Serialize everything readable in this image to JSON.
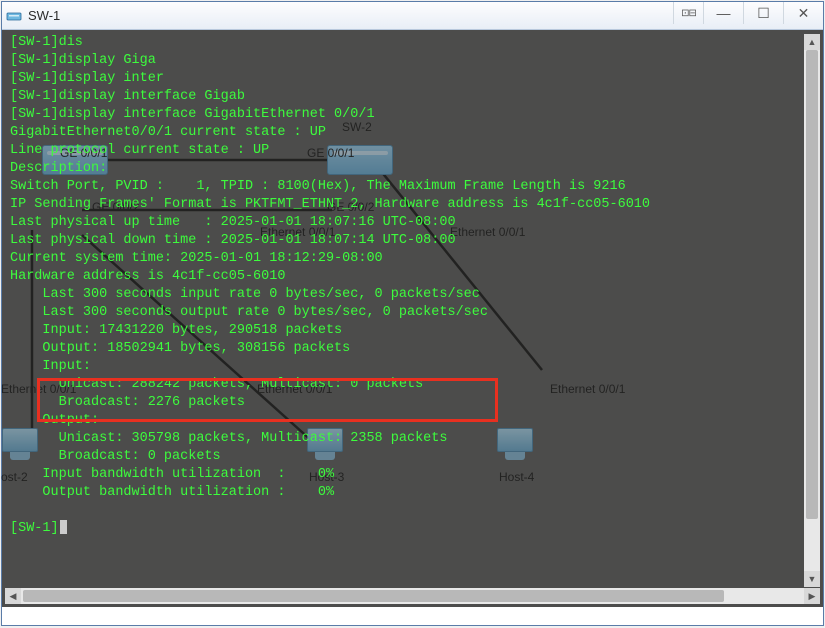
{
  "window": {
    "title": "SW-1"
  },
  "topology": {
    "sw2_label": "SW-2",
    "host2_label": "ost-2",
    "host3_label": "Host-3",
    "host4_label": "Host-4",
    "ge001_a": "GE 0/0/1",
    "ge001_b": "GE 0/0/1",
    "ge002_a": "GE 0/0/2",
    "ge002_b": "GE 0/0/2",
    "eth001_a": "Ethernet 0/0/1",
    "eth001_b": "Ethernet 0/0/1",
    "eth001_c": "Ethernet 0/0/1"
  },
  "terminal": {
    "lines": [
      "[SW-1]dis",
      "[SW-1]display Giga",
      "[SW-1]display inter",
      "[SW-1]display interface Gigab",
      "[SW-1]display interface GigabitEthernet 0/0/1",
      "GigabitEthernet0/0/1 current state : UP",
      "Line protocol current state : UP",
      "Description:",
      "Switch Port, PVID :    1, TPID : 8100(Hex), The Maximum Frame Length is 9216",
      "IP Sending Frames' Format is PKTFMT_ETHNT_2, Hardware address is 4c1f-cc05-6010",
      "Last physical up time   : 2025-01-01 18:07:16 UTC-08:00",
      "Last physical down time : 2025-01-01 18:07:14 UTC-08:00",
      "Current system time: 2025-01-01 18:12:29-08:00",
      "Hardware address is 4c1f-cc05-6010",
      "    Last 300 seconds input rate 0 bytes/sec, 0 packets/sec",
      "    Last 300 seconds output rate 0 bytes/sec, 0 packets/sec",
      "    Input: 17431220 bytes, 290518 packets",
      "    Output: 18502941 bytes, 308156 packets",
      "    Input:",
      "      Unicast: 288242 packets, Multicast: 0 packets",
      "      Broadcast: 2276 packets",
      "    Output:",
      "      Unicast: 305798 packets, Multicast: 2358 packets",
      "      Broadcast: 0 packets",
      "    Input bandwidth utilization  :    0%",
      "    Output bandwidth utilization :    0%",
      "",
      "[SW-1]"
    ]
  },
  "chart_data": {
    "type": "table",
    "title": "display interface GigabitEthernet 0/0/1",
    "rows": [
      {
        "field": "Interface",
        "value": "GigabitEthernet0/0/1"
      },
      {
        "field": "Current state",
        "value": "UP"
      },
      {
        "field": "Line protocol current state",
        "value": "UP"
      },
      {
        "field": "Description",
        "value": ""
      },
      {
        "field": "Switch Port PVID",
        "value": 1
      },
      {
        "field": "TPID (Hex)",
        "value": "8100"
      },
      {
        "field": "Maximum Frame Length",
        "value": 9216
      },
      {
        "field": "IP Sending Frames' Format",
        "value": "PKTFMT_ETHNT_2"
      },
      {
        "field": "Hardware address",
        "value": "4c1f-cc05-6010"
      },
      {
        "field": "Last physical up time",
        "value": "2025-01-01 18:07:16 UTC-08:00"
      },
      {
        "field": "Last physical down time",
        "value": "2025-01-01 18:07:14 UTC-08:00"
      },
      {
        "field": "Current system time",
        "value": "2025-01-01 18:12:29-08:00"
      },
      {
        "field": "Last 300s input rate bytes/sec",
        "value": 0
      },
      {
        "field": "Last 300s input rate packets/sec",
        "value": 0
      },
      {
        "field": "Last 300s output rate bytes/sec",
        "value": 0
      },
      {
        "field": "Last 300s output rate packets/sec",
        "value": 0
      },
      {
        "field": "Input bytes",
        "value": 17431220
      },
      {
        "field": "Input packets",
        "value": 290518
      },
      {
        "field": "Output bytes",
        "value": 18502941
      },
      {
        "field": "Output packets",
        "value": 308156
      },
      {
        "field": "Input Unicast packets",
        "value": 288242
      },
      {
        "field": "Input Multicast packets",
        "value": 0
      },
      {
        "field": "Input Broadcast packets",
        "value": 2276
      },
      {
        "field": "Output Unicast packets",
        "value": 305798
      },
      {
        "field": "Output Multicast packets",
        "value": 2358
      },
      {
        "field": "Output Broadcast packets",
        "value": 0
      },
      {
        "field": "Input bandwidth utilization",
        "value": "0%"
      },
      {
        "field": "Output bandwidth utilization",
        "value": "0%"
      }
    ]
  }
}
